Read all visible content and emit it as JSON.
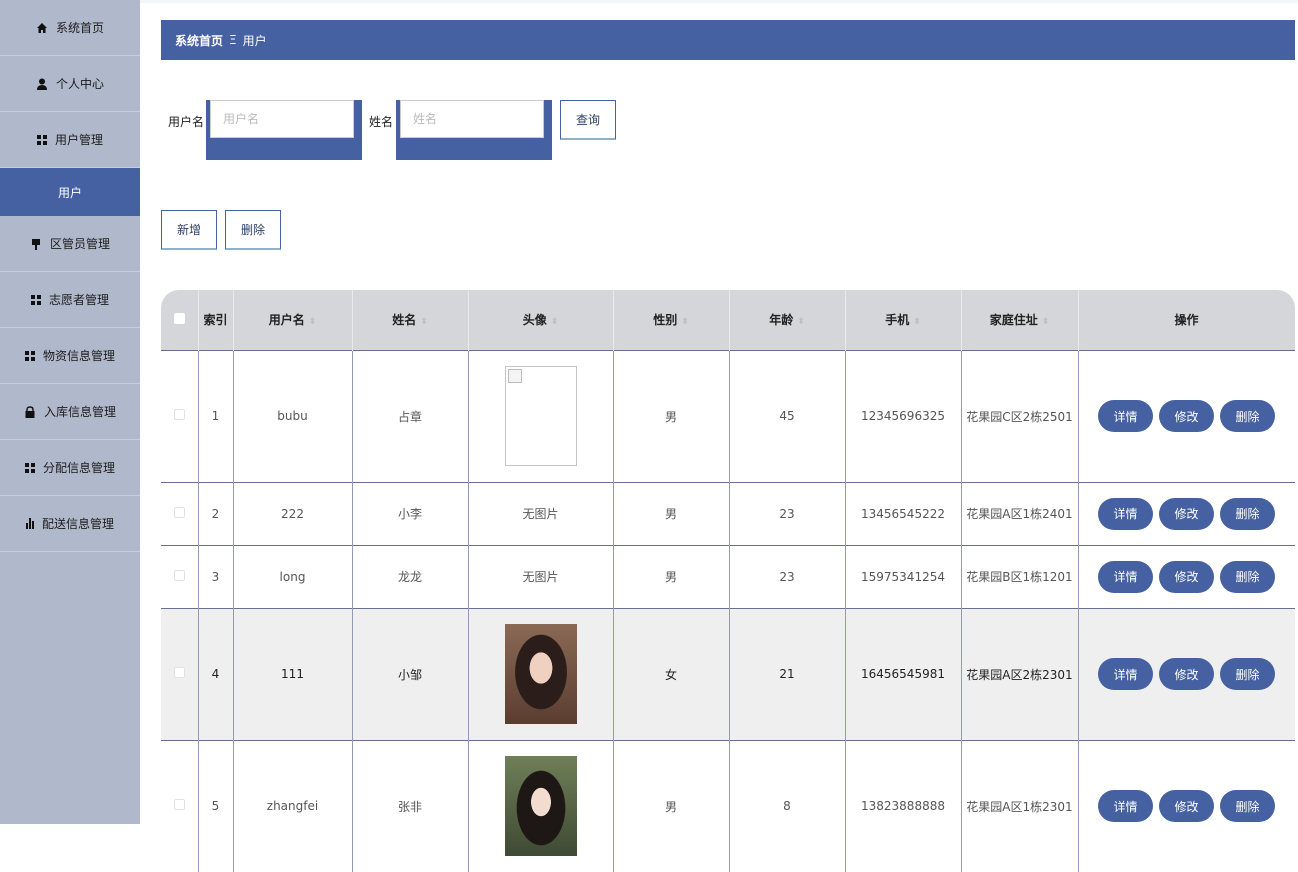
{
  "sidebar": {
    "items": [
      {
        "label": "系统首页",
        "icon": "home-icon"
      },
      {
        "label": "个人中心",
        "icon": "person-icon"
      },
      {
        "label": "用户管理",
        "icon": "grid-icon"
      },
      {
        "label": "区管员管理",
        "icon": "pin-icon"
      },
      {
        "label": "志愿者管理",
        "icon": "grid-icon"
      },
      {
        "label": "物资信息管理",
        "icon": "grid-icon"
      },
      {
        "label": "入库信息管理",
        "icon": "lock-icon"
      },
      {
        "label": "分配信息管理",
        "icon": "grid-icon"
      },
      {
        "label": "配送信息管理",
        "icon": "bar-chart-icon"
      }
    ],
    "active_sub": "用户"
  },
  "breadcrumb": {
    "home": "系统首页",
    "separator": "Ξ",
    "current": "用户"
  },
  "search": {
    "username_label": "用户名",
    "username_placeholder": "用户名",
    "name_label": "姓名",
    "name_placeholder": "姓名",
    "query_button": "查询"
  },
  "actions": {
    "add": "新增",
    "delete": "删除"
  },
  "table": {
    "columns": [
      "索引",
      "用户名",
      "姓名",
      "头像",
      "性别",
      "年龄",
      "手机",
      "家庭住址",
      "操作"
    ],
    "rows": [
      {
        "index": "1",
        "username": "bubu",
        "name": "占章",
        "avatar": "broken",
        "avatar_text": "",
        "gender": "男",
        "age": "45",
        "phone": "12345696325",
        "address": "花果园C区2栋2501"
      },
      {
        "index": "2",
        "username": "222",
        "name": "小李",
        "avatar": "none",
        "avatar_text": "无图片",
        "gender": "男",
        "age": "23",
        "phone": "13456545222",
        "address": "花果园A区1栋2401"
      },
      {
        "index": "3",
        "username": "long",
        "name": "龙龙",
        "avatar": "none",
        "avatar_text": "无图片",
        "gender": "男",
        "age": "23",
        "phone": "15975341254",
        "address": "花果园B区1栋1201"
      },
      {
        "index": "4",
        "username": "111",
        "name": "小邹",
        "avatar": "photo1",
        "avatar_text": "",
        "gender": "女",
        "age": "21",
        "phone": "16456545981",
        "address": "花果园A区2栋2301"
      },
      {
        "index": "5",
        "username": "zhangfei",
        "name": "张非",
        "avatar": "photo2",
        "avatar_text": "",
        "gender": "男",
        "age": "8",
        "phone": "13823888888",
        "address": "花果园A区1栋2301"
      }
    ],
    "row_buttons": {
      "detail": "详情",
      "edit": "修改",
      "delete": "删除"
    }
  },
  "colors": {
    "accent": "#4661a1",
    "sidebar_bg": "#b0b8cb",
    "header_bg": "#d5d6d9"
  }
}
